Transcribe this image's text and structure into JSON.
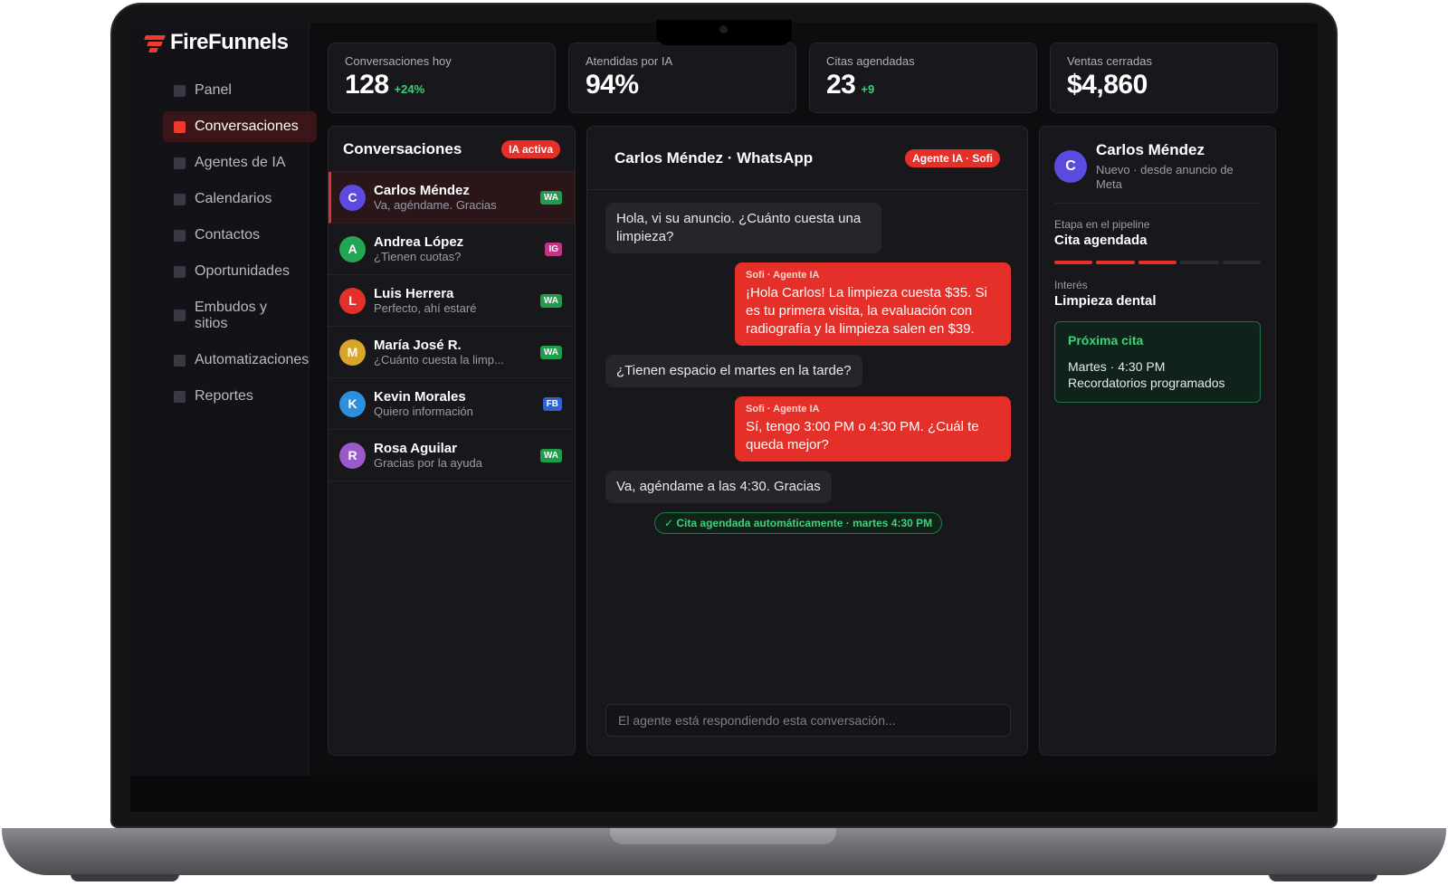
{
  "app": {
    "logo_text": "FireFunnels"
  },
  "sidebar": {
    "items": [
      {
        "label": "Panel"
      },
      {
        "label": "Conversaciones",
        "active": true
      },
      {
        "label": "Agentes de IA"
      },
      {
        "label": "Calendarios"
      },
      {
        "label": "Contactos"
      },
      {
        "label": "Oportunidades"
      },
      {
        "label": "Embudos y sitios"
      },
      {
        "label": "Automatizaciones"
      },
      {
        "label": "Reportes"
      }
    ]
  },
  "stats": [
    {
      "label": "Conversaciones hoy",
      "value": "128",
      "delta": "+24%"
    },
    {
      "label": "Atendidas por IA",
      "value": "94%",
      "delta": ""
    },
    {
      "label": "Citas agendadas",
      "value": "23",
      "delta": "+9"
    },
    {
      "label": "Ventas cerradas",
      "value": "$4,860",
      "delta": ""
    }
  ],
  "conversations": {
    "title": "Conversaciones",
    "badge": "IA activa",
    "items": [
      {
        "initial": "C",
        "name": "Carlos Méndez",
        "preview": "Va, agéndame. Gracias",
        "channel": "WA",
        "color": "#5b4be0"
      },
      {
        "initial": "A",
        "name": "Andrea López",
        "preview": "¿Tienen cuotas?",
        "channel": "IG",
        "color": "#22a653"
      },
      {
        "initial": "L",
        "name": "Luis Herrera",
        "preview": "Perfecto, ahí estaré",
        "channel": "WA",
        "color": "#e5302a"
      },
      {
        "initial": "M",
        "name": "María José R.",
        "preview": "¿Cuánto cuesta la limp...",
        "channel": "WA",
        "color": "#d9a62a"
      },
      {
        "initial": "K",
        "name": "Kevin Morales",
        "preview": "Quiero información",
        "channel": "FB",
        "color": "#2d8fe0"
      },
      {
        "initial": "R",
        "name": "Rosa Aguilar",
        "preview": "Gracias por la ayuda",
        "channel": "WA",
        "color": "#9b59c9"
      }
    ]
  },
  "chat": {
    "title": "Carlos Méndez · WhatsApp",
    "agent_badge": "Agente IA · Sofi",
    "messages": [
      {
        "dir": "in",
        "text": "Hola, vi su anuncio. ¿Cuánto cuesta una limpieza?"
      },
      {
        "dir": "out",
        "from": "Sofi · Agente IA",
        "text": "¡Hola Carlos! La limpieza cuesta $35. Si es tu primera visita, la evaluación con radiografía y la limpieza salen en $39."
      },
      {
        "dir": "in",
        "text": "¿Tienen espacio el martes en la tarde?"
      },
      {
        "dir": "out",
        "from": "Sofi · Agente IA",
        "text": "Sí, tengo 3:00 PM o 4:30 PM. ¿Cuál te queda mejor?"
      },
      {
        "dir": "in",
        "text": "Va, agéndame a las 4:30. Gracias"
      }
    ],
    "confirmation": "✓ Cita agendada automáticamente · martes 4:30 PM",
    "input_placeholder": "El agente está respondiendo esta conversación..."
  },
  "contact": {
    "initial": "C",
    "name": "Carlos Méndez",
    "subtitle": "Nuevo · desde anuncio de Meta",
    "pipeline_label": "Etapa en el pipeline",
    "pipeline_value": "Cita agendada",
    "pipeline_steps_done": 3,
    "pipeline_steps_total": 5,
    "interest_label": "Interés",
    "interest_value": "Limpieza dental",
    "next": {
      "title": "Próxima cita",
      "line1": "Martes · 4:30 PM",
      "line2": "Recordatorios programados"
    }
  },
  "colors": {
    "accent": "#e5302a",
    "success": "#3fd17a",
    "bg": "#0d0d10",
    "panel": "#17171c"
  }
}
